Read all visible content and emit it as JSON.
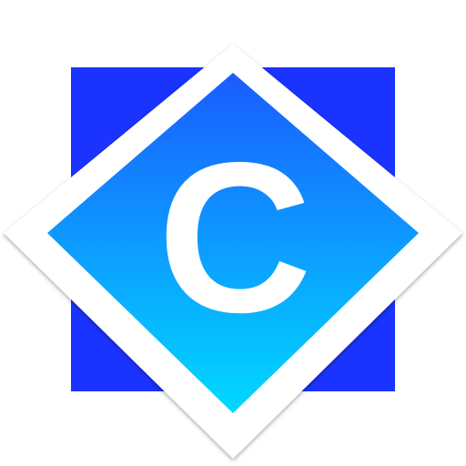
{
  "logo": {
    "letter": "C",
    "colors": {
      "back_square": "#1a33ff",
      "diamond_gradient_top": "#1a5cff",
      "diamond_gradient_bottom": "#00d9ff",
      "border": "#ffffff",
      "letter": "#ffffff"
    }
  }
}
